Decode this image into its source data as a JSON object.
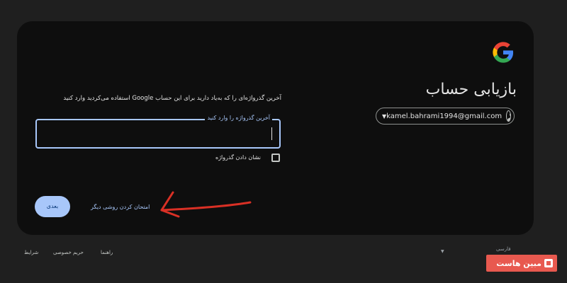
{
  "page": {
    "heading": "بازیابی حساب",
    "instruction": "آخرین گذرواژه‌ای را که به‌یاد دارید برای این حساب Google استفاده می‌کردید وارد کنید"
  },
  "account": {
    "email": "kamel.bahrami1994@gmail.com"
  },
  "password_field": {
    "label": "آخرین گذرواژه را وارد کنید",
    "value": ""
  },
  "show_password": {
    "label": "نشان دادن گذرواژه",
    "checked": false
  },
  "actions": {
    "next_label": "بعدی",
    "try_another_label": "امتحان کردن روشی دیگر"
  },
  "footer": {
    "language": "فارسی",
    "help": "راهنما",
    "privacy": "حریم خصوصی",
    "terms": "شرایط"
  },
  "watermark": {
    "text": "مبین هاست"
  },
  "colors": {
    "background": "#1f1f1f",
    "card": "#0e0e0e",
    "accent": "#a8c7fa",
    "annotation_arrow": "#d93025",
    "badge": "#e8594f"
  },
  "icons": {
    "logo": "google-logo",
    "avatar": "account-circle-icon",
    "dropdown": "caret-down-icon"
  }
}
